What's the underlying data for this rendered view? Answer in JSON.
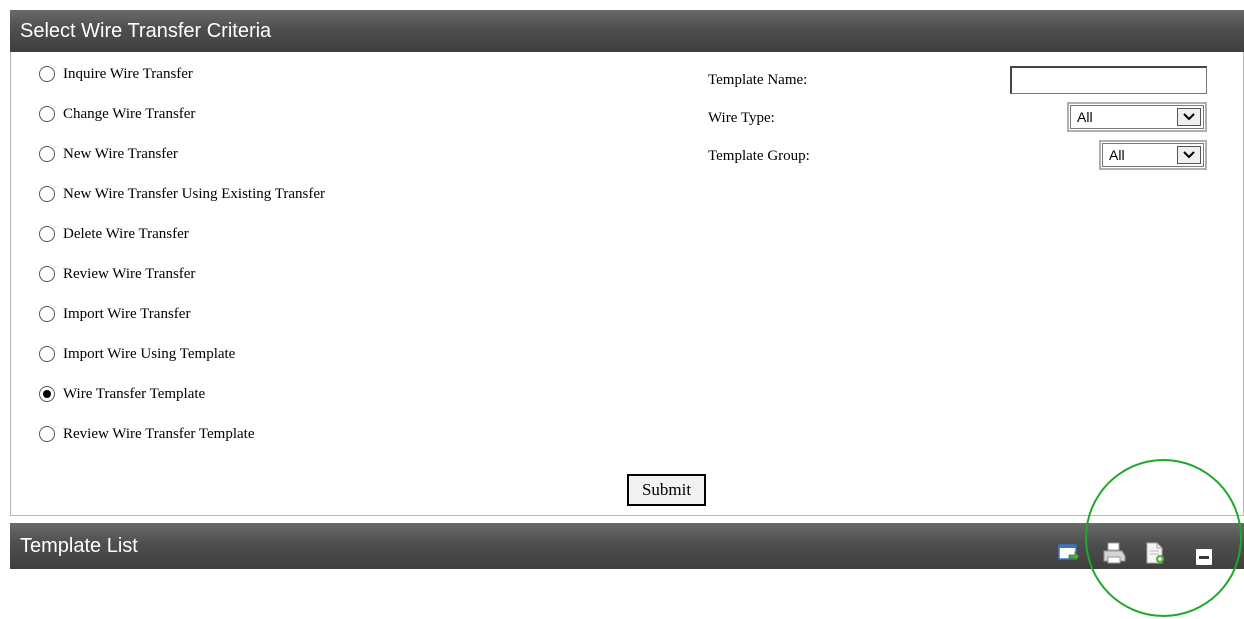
{
  "criteria_panel": {
    "title": "Select Wire Transfer Criteria"
  },
  "options": [
    {
      "label": "Inquire Wire Transfer",
      "selected": false
    },
    {
      "label": "Change Wire Transfer",
      "selected": false
    },
    {
      "label": "New Wire Transfer",
      "selected": false
    },
    {
      "label": "New Wire Transfer Using Existing Transfer",
      "selected": false
    },
    {
      "label": "Delete Wire Transfer",
      "selected": false
    },
    {
      "label": "Review Wire Transfer",
      "selected": false
    },
    {
      "label": "Import Wire Transfer",
      "selected": false
    },
    {
      "label": "Import Wire Using Template",
      "selected": false
    },
    {
      "label": "Wire Transfer Template",
      "selected": true
    },
    {
      "label": "Review Wire Transfer Template",
      "selected": false
    }
  ],
  "filters": {
    "template_name_label": "Template Name:",
    "template_name_value": "",
    "wire_type_label": "Wire Type:",
    "wire_type_value": "All",
    "template_group_label": "Template Group:",
    "template_group_value": "All"
  },
  "submit_label": "Submit",
  "template_list": {
    "title": "Template List",
    "icons": [
      "export-icon",
      "print-icon",
      "new-document-icon",
      "collapse-icon"
    ]
  },
  "colors": {
    "header_bg": "#4e4e4e",
    "highlight": "#1fa82a"
  }
}
